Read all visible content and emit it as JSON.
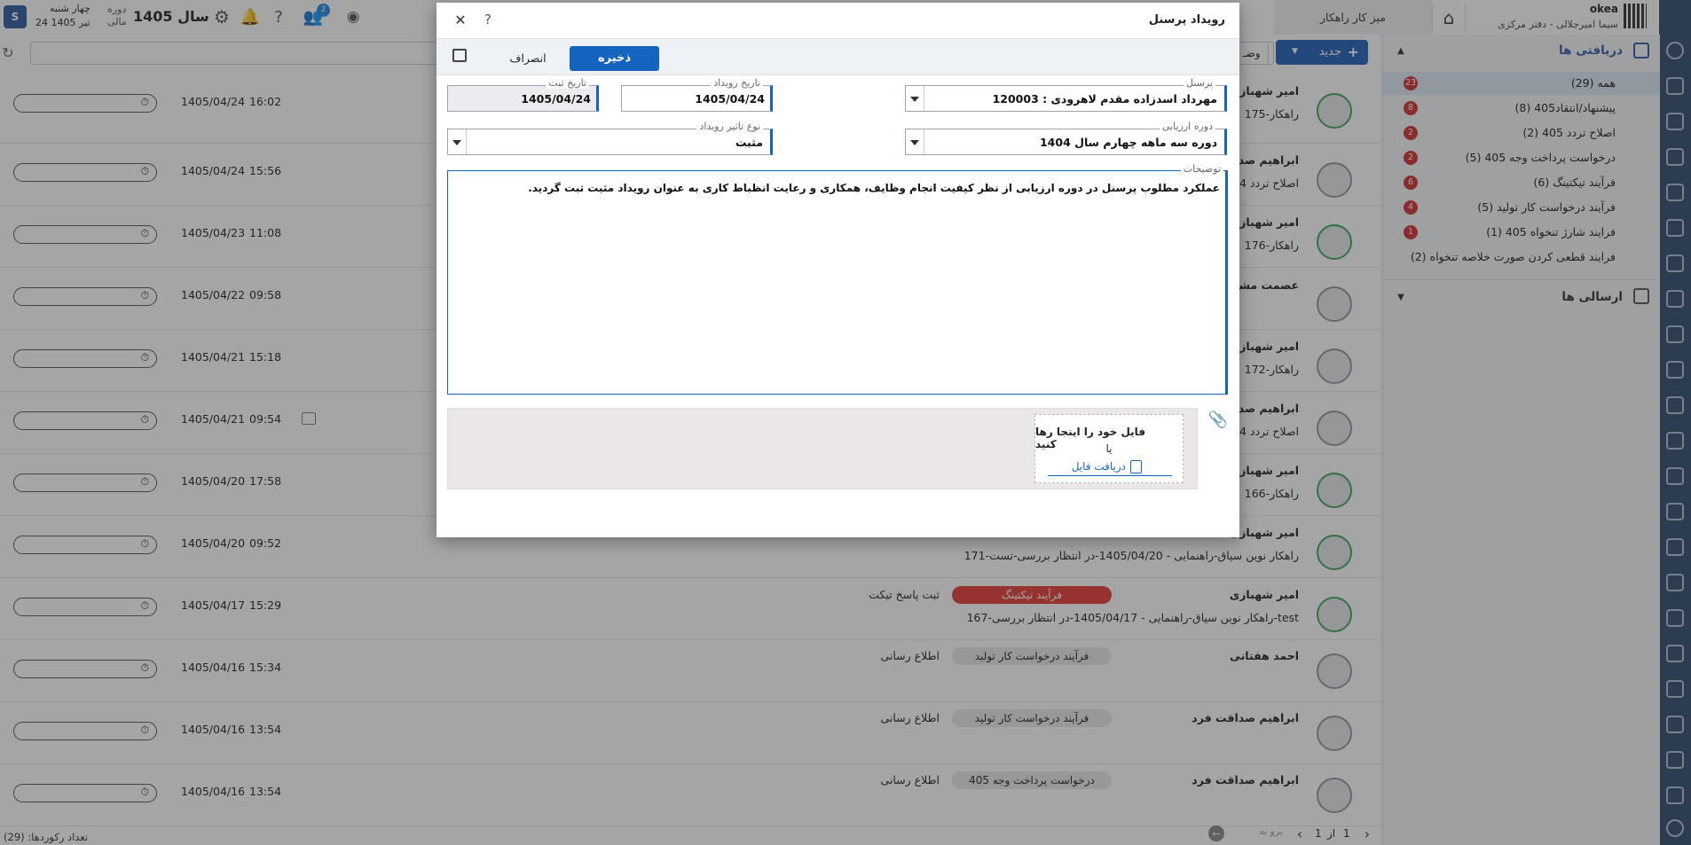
{
  "top": {
    "org": "okea",
    "user": "سیما امیرجلالی - دفتر مرکزی",
    "desk_tab": "میز کار راهکار",
    "year": "سال 1405",
    "period_label_1": "دوره",
    "period_label_2": "مالی",
    "weekday": "چهار شنبه",
    "date": "24 تیر 1405",
    "notif_count": "2"
  },
  "toolbar": {
    "new_label": "جدید",
    "partial_button": "وضـ"
  },
  "inbox": {
    "title": "دریافتی ها",
    "sent_title": "ارسالی ها",
    "items": [
      {
        "label": "همه (29)",
        "badge": "23"
      },
      {
        "label": "پیشنهاد/انتقاد405 (8)",
        "badge": "8"
      },
      {
        "label": "اصلاح تردد 405 (2)",
        "badge": "2"
      },
      {
        "label": "درخواست پرداخت وجه 405 (5)",
        "badge": "2"
      },
      {
        "label": "فرآیند تیکتینگ (6)",
        "badge": "6"
      },
      {
        "label": "فرآیند درخواست کار تولید (5)",
        "badge": "4"
      },
      {
        "label": "فرایند شارژ تنخواه 405 (1)",
        "badge": "1"
      },
      {
        "label": "فرایند قطعی کردن صورت خلاصه تنخواه (2)",
        "badge": ""
      }
    ]
  },
  "rows": [
    {
      "name": "امیر شهبازی",
      "line2": "175-راهکار",
      "tag": "",
      "action": "",
      "date": "1405/04/24",
      "time": "16:02"
    },
    {
      "name": "ابراهیم صداقت",
      "line2": "اصلاح تردد 4",
      "tag": "",
      "action": "",
      "date": "1405/04/24",
      "time": "15:56"
    },
    {
      "name": "امیر شهبازی",
      "line2": "176-راهکار",
      "tag": "",
      "action": "",
      "date": "1405/04/23",
      "time": "11:08"
    },
    {
      "name": "عصمت مشـ",
      "line2": "",
      "tag": "",
      "action": "",
      "date": "1405/04/22",
      "time": "09:58"
    },
    {
      "name": "امیر شهبازی",
      "line2": "172-راهکار",
      "tag": "",
      "action": "",
      "date": "1405/04/21",
      "time": "15:18"
    },
    {
      "name": "ابراهیم صداقت",
      "line2": "اصلاح تردد 4",
      "tag": "",
      "action": "",
      "date": "1405/04/21",
      "time": "09:54"
    },
    {
      "name": "امیر شهبازی",
      "line2": "166-راهکار",
      "tag": "",
      "action": "",
      "date": "1405/04/20",
      "time": "17:58"
    },
    {
      "name": "امیر شهبازی",
      "line2": "171-راهکار نوین سیاق-راهنمایی - 1405/04/20-در انتظار بررسی-تست",
      "tag": "",
      "action": "",
      "date": "1405/04/20",
      "time": "09:52"
    },
    {
      "name": "امیر شهبازی",
      "line2": "167-راهکار نوین سیاق-راهنمایی - 1405/04/17-در انتظار بررسی-test",
      "tag": "فرآیند تیکتینگ",
      "action": "ثبت پاسخ تیکت",
      "date": "1405/04/17",
      "time": "15:29"
    },
    {
      "name": "احمد هفتانی",
      "line2": "",
      "tag": "فرآیند درخواست کار تولید",
      "action": "اطلاع رسانی",
      "date": "1405/04/16",
      "time": "15:34"
    },
    {
      "name": "ابراهیم صداقت فرد",
      "line2": "",
      "tag": "فرآیند درخواست کار تولید",
      "action": "اطلاع رسانی",
      "date": "1405/04/16",
      "time": "13:54"
    },
    {
      "name": "ابراهیم صداقت فرد",
      "line2": "",
      "tag": "درخواست پرداخت وجه 405",
      "action": "اطلاع رسانی",
      "date": "1405/04/16",
      "time": "13:54"
    }
  ],
  "footer": {
    "record_count": "تعداد رکوردها: (29)",
    "page_current": "1",
    "page_of": "از",
    "page_total": "1",
    "goto": "برو به"
  },
  "modal": {
    "title": "رویداد پرسنل",
    "save": "ذخیره",
    "cancel": "انصراف",
    "personnel_label": "پرسنل",
    "personnel_value": "120003 : مهرداد اسدزاده مقدم لاهرودی",
    "event_date_label": "تاریخ رویداد",
    "event_date_value": "1405/04/24",
    "reg_date_label": "تاریخ ثبت",
    "reg_date_value": "1405/04/24",
    "period_label": "دوره ارزیابی",
    "period_value": "دوره سه ماهه چهارم سال 1404",
    "impact_label": "نوع تاثیر رویداد",
    "impact_value": "مثبت",
    "desc_label": "توضیحات",
    "desc_value": "عملکرد مطلوب پرسنل در دوره ارزیابی از نظر کیفیت انجام وظایف، همکاری و رعایت انظباط کاری به عنوان رویداد مثبت ثبت گردید.",
    "drop_text": "فایل خود را اینجا رها کنید",
    "drop_or": "یا",
    "drop_link": "دریافت فایل"
  },
  "colors": {
    "primary": "#1565c0",
    "badge": "#d32f2f",
    "tag_red": "#e53935",
    "rail": "#2f4d6e"
  }
}
